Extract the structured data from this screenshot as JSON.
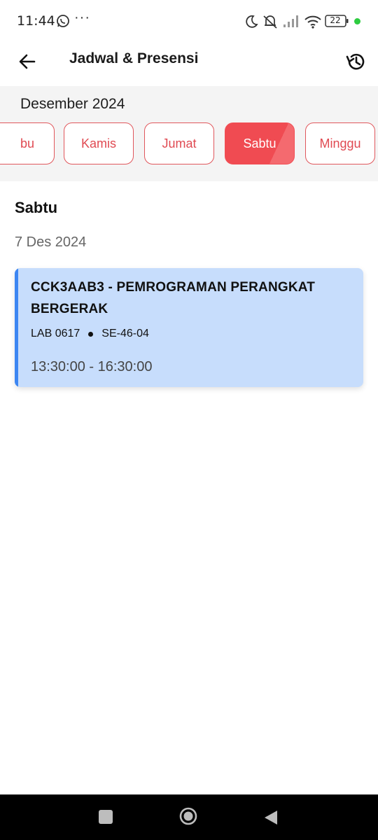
{
  "status_bar": {
    "time": "11:44",
    "more": "···",
    "battery": "22",
    "icons": [
      "whatsapp-icon",
      "moon-icon",
      "mute-icon",
      "signal-icon",
      "wifi-icon",
      "battery-icon"
    ]
  },
  "header": {
    "title": "Jadwal & Presensi",
    "back_icon": "arrow-left-icon",
    "history_icon": "history-icon"
  },
  "calendar": {
    "month": "Desember 2024",
    "days": [
      "bu",
      "Kamis",
      "Jumat",
      "Sabtu",
      "Minggu"
    ],
    "selected": "Sabtu"
  },
  "content": {
    "day": "Sabtu",
    "date": "7 Des 2024",
    "schedule": [
      {
        "course": "CCK3AAB3 - PEMROGRAMAN PERANGKAT BERGERAK",
        "room": "LAB 0617",
        "class": "SE-46-04",
        "time": "13:30:00 - 16:30:00"
      }
    ]
  },
  "colors": {
    "accent_red": "#f24f55",
    "card_blue": "#c7ddfc",
    "card_accent": "#3c86f2"
  }
}
